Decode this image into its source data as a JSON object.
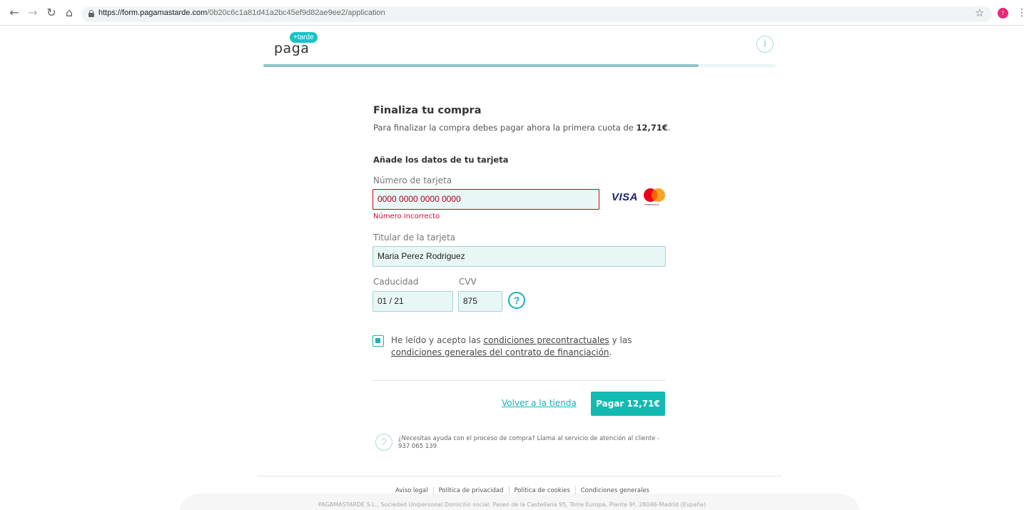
{
  "browser": {
    "url_host": "https://form.pagamastarde.com",
    "url_path": "/0b20c6c1a81d41a2bc45ef9d82ae9ee2/application",
    "avatar_initial": "!"
  },
  "header": {
    "logo_badge": "+tarde",
    "logo_word": "paga",
    "info_icon": "i",
    "progress": 0.85
  },
  "form": {
    "title": "Finaliza tu compra",
    "subtitle_prefix": "Para finalizar la compra debes pagar ahora la primera cuota de ",
    "subtitle_amount": "12,71€",
    "subtitle_suffix": ".",
    "card_section_title": "Añade los datos de tu tarjeta",
    "card_number_label": "Número de tarjeta",
    "card_number_value": "0000 0000 0000 0000",
    "card_number_error": "Número incorrecto",
    "visa_label": "VISA",
    "mastercard_label": "mastercard",
    "holder_label": "Titular de la tarjeta",
    "holder_value": "Maria Perez Rodriguez",
    "expiry_label": "Caducidad",
    "expiry_value": "01 / 21",
    "cvv_label": "CVV",
    "cvv_value": "875",
    "cvv_help": "?",
    "terms_prefix": "He leído y acepto las ",
    "terms_link1": "condiciones precontractuales",
    "terms_middle": " y las ",
    "terms_link2": "condiciones generales del contrato de financiación",
    "terms_suffix": ".",
    "terms_checked": true,
    "back_link": "Volver a la tienda",
    "pay_button": "Pagar 12,71€"
  },
  "support": {
    "icon": "?",
    "text": "¿Necesitas ayuda con el proceso de compra? Llama al servicio de atención al cliente - 937 065 139"
  },
  "footer": {
    "links": [
      "Aviso legal",
      "Política de privacidad",
      "Política de cookies",
      "Condiciones generales"
    ],
    "address": "PAGAMASTARDE S.L., Sociedad Unipersonal Domicilio social: Paseo de la Castellana 95, Torre Europa, Planta 9ª, 28046-Madrid (España)"
  },
  "colors": {
    "accent": "#17b2bb",
    "button": "#13bab1",
    "error": "#c8102e",
    "field_bg": "#e8f6f6"
  }
}
